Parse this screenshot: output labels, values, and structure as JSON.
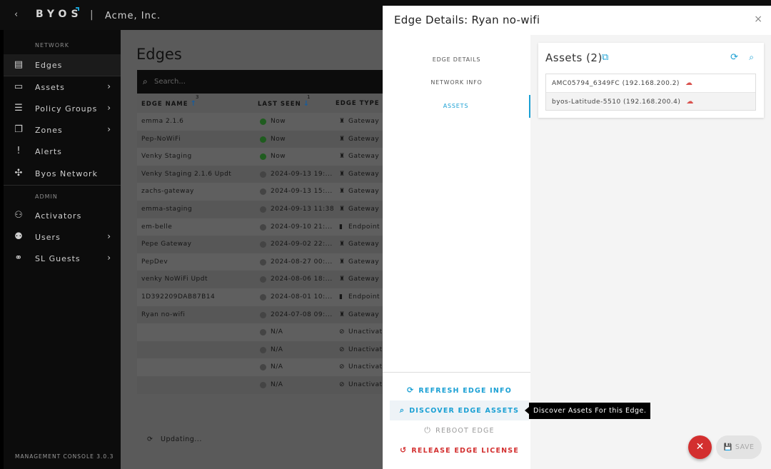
{
  "topbar": {
    "back_icon": "‹",
    "logo": "BYOS",
    "separator": "|",
    "org": "Acme, Inc."
  },
  "sidebar": {
    "network_section": "NETWORK",
    "admin_section": "ADMIN",
    "items": [
      {
        "label": "Edges",
        "icon": "edges-icon",
        "chevron": false
      },
      {
        "label": "Assets",
        "icon": "laptop-icon",
        "chevron": true
      },
      {
        "label": "Policy Groups",
        "icon": "policy-icon",
        "chevron": true
      },
      {
        "label": "Zones",
        "icon": "zones-icon",
        "chevron": true
      },
      {
        "label": "Alerts",
        "icon": "alert-icon",
        "chevron": false
      },
      {
        "label": "Byos Network",
        "icon": "network-icon",
        "chevron": false
      },
      {
        "label": "Activators",
        "icon": "activators-icon",
        "chevron": false
      },
      {
        "label": "Users",
        "icon": "users-icon",
        "chevron": true
      },
      {
        "label": "SL Guests",
        "icon": "guests-icon",
        "chevron": true
      }
    ],
    "footer": "MANAGEMENT CONSOLE 3.0.3"
  },
  "main": {
    "title": "Edges",
    "search_placeholder": "Search...",
    "columns": {
      "name": "EDGE NAME",
      "name_sort": "3",
      "last_seen": "LAST SEEN",
      "last_seen_sort": "1",
      "type": "EDGE TYPE"
    },
    "rows": [
      {
        "name": "emma 2.1.6",
        "status": "green",
        "seen": "Now",
        "type": "Gateway"
      },
      {
        "name": "Pep-NoWiFi",
        "status": "green",
        "seen": "Now",
        "type": "Gateway"
      },
      {
        "name": "Venky Staging",
        "status": "green",
        "seen": "Now",
        "type": "Gateway"
      },
      {
        "name": "Venky Staging 2.1.6 Updt",
        "status": "gray",
        "seen": "2024-09-13 19:...",
        "type": "Gateway"
      },
      {
        "name": "zachs-gateway",
        "status": "gray",
        "seen": "2024-09-13 15:...",
        "type": "Gateway"
      },
      {
        "name": "emma-staging",
        "status": "gray",
        "seen": "2024-09-13 11:38",
        "type": "Gateway"
      },
      {
        "name": "em-belle",
        "status": "gray",
        "seen": "2024-09-10 21:...",
        "type": "Endpoint"
      },
      {
        "name": "Pepe Gateway",
        "status": "gray",
        "seen": "2024-09-02 22:...",
        "type": "Gateway"
      },
      {
        "name": "PepDev",
        "status": "gray",
        "seen": "2024-08-27 00:...",
        "type": "Gateway"
      },
      {
        "name": "venky NoWiFi Updt",
        "status": "gray",
        "seen": "2024-08-06 18:...",
        "type": "Gateway"
      },
      {
        "name": "1D392209DAB87B14",
        "status": "gray",
        "seen": "2024-08-01 10:...",
        "type": "Endpoint"
      },
      {
        "name": "Ryan no-wifi",
        "status": "gray",
        "seen": "2024-07-08 09:...",
        "type": "Gateway"
      },
      {
        "name": "",
        "status": "gray",
        "seen": "N/A",
        "type": "Unactivated"
      },
      {
        "name": "",
        "status": "gray",
        "seen": "N/A",
        "type": "Unactivated"
      },
      {
        "name": "",
        "status": "gray",
        "seen": "N/A",
        "type": "Unactivated"
      },
      {
        "name": "",
        "status": "gray",
        "seen": "N/A",
        "type": "Unactivated"
      }
    ],
    "updating": "Updating..."
  },
  "drawer": {
    "title": "Edge Details: Ryan no-wifi",
    "close": "×",
    "tabs": [
      "EDGE DETAILS",
      "NETWORK INFO",
      "ASSETS"
    ],
    "active_tab": 2,
    "actions": {
      "refresh": "REFRESH EDGE INFO",
      "discover": "DISCOVER EDGE ASSETS",
      "reboot": "REBOOT EDGE",
      "release": "RELEASE EDGE LICENSE"
    },
    "tooltip": "Discover Assets For this Edge.",
    "assets": {
      "title": "Assets (2)",
      "items": [
        "AMC05794_6349FC (192.168.200.2)",
        "byos-Latitude-5510 (192.168.200.4)"
      ]
    },
    "save_label": "SAVE",
    "colors": {
      "accent": "#1aa0d4",
      "danger": "#d32f2f"
    }
  }
}
